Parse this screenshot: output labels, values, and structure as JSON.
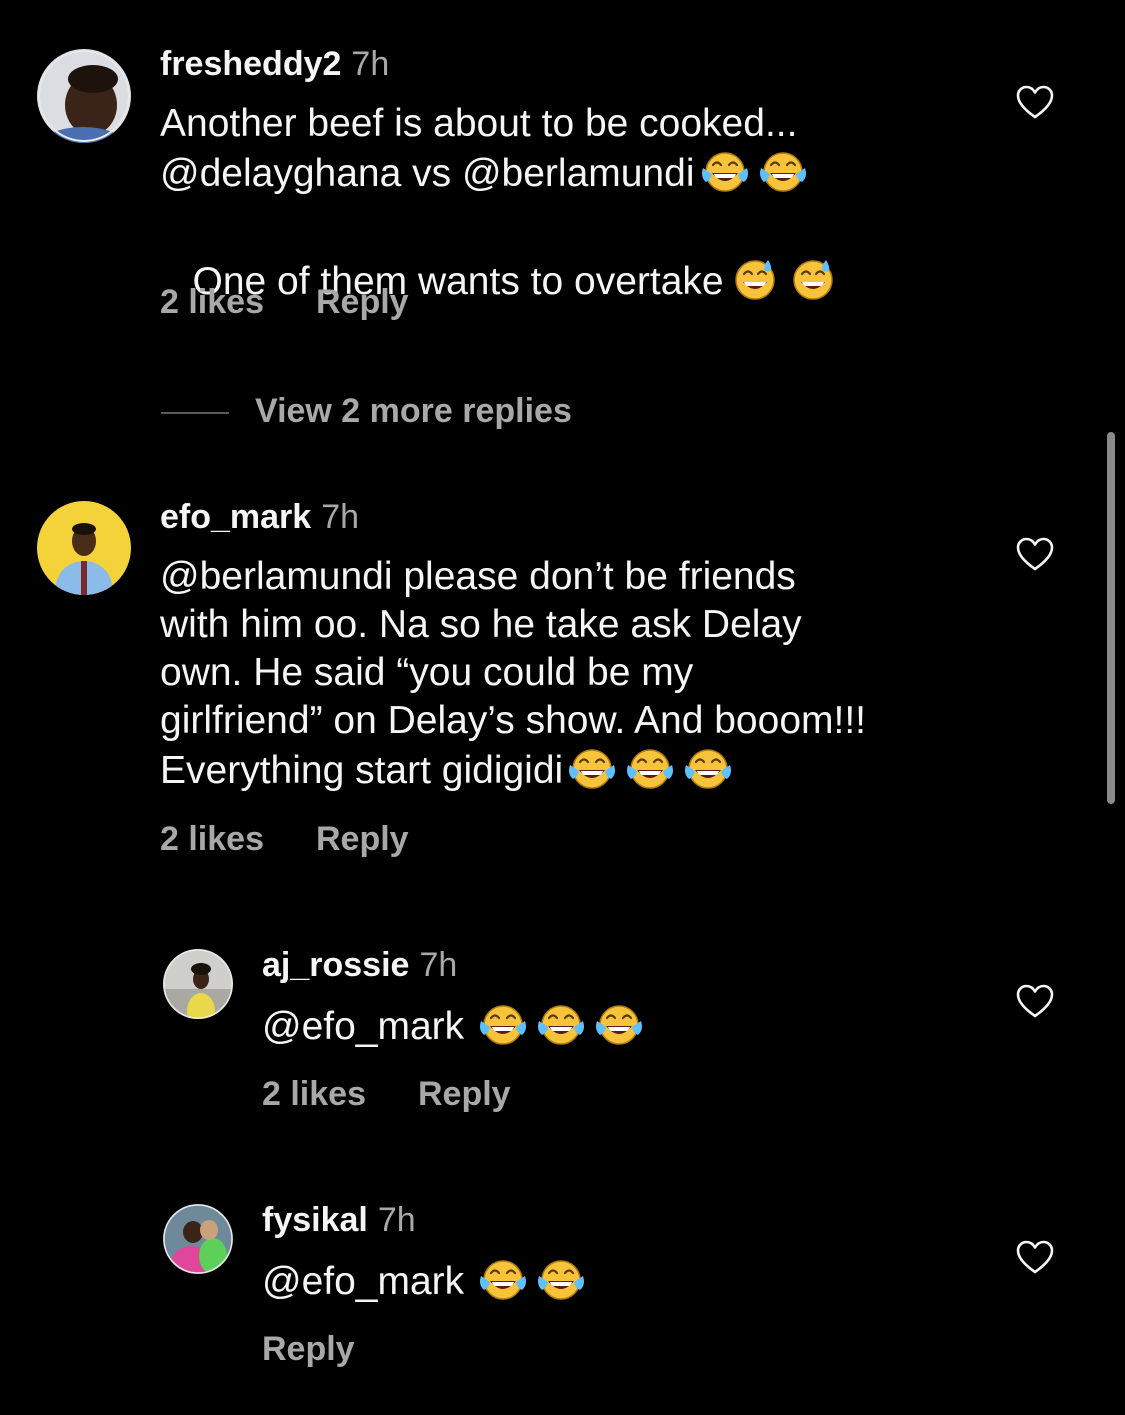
{
  "icons": {
    "heart": "heart-outline-icon",
    "laugh": "face-with-tears-of-joy-emoji",
    "sweat": "grinning-face-with-sweat-emoji"
  },
  "colors": {
    "background": "#000000",
    "primary_text": "#f5f5f5",
    "secondary_text": "#a8a8a8"
  },
  "comments": [
    {
      "username": "fresheddy2",
      "time": "7h",
      "lines": [
        "Another beef is about to be cooked...",
        "@delayghana vs @berlamundi",
        " One of them wants to overtake"
      ],
      "likes": "2 likes",
      "reply": "Reply"
    },
    {
      "view_more": "View 2 more replies"
    },
    {
      "username": "efo_mark",
      "time": "7h",
      "lines": [
        "@berlamundi please don’t be friends",
        "with him oo. Na so he take ask Delay",
        "own. He said “you could be my",
        "girlfriend” on Delay’s show. And booom!!!",
        "Everything start gidigidi"
      ],
      "likes": "2 likes",
      "reply": "Reply"
    },
    {
      "username": "aj_rossie",
      "time": "7h",
      "lines": [
        "@efo_mark"
      ],
      "likes": "2 likes",
      "reply": "Reply"
    },
    {
      "username": "fysikal",
      "time": "7h",
      "lines": [
        "@efo_mark"
      ],
      "reply": "Reply"
    }
  ]
}
